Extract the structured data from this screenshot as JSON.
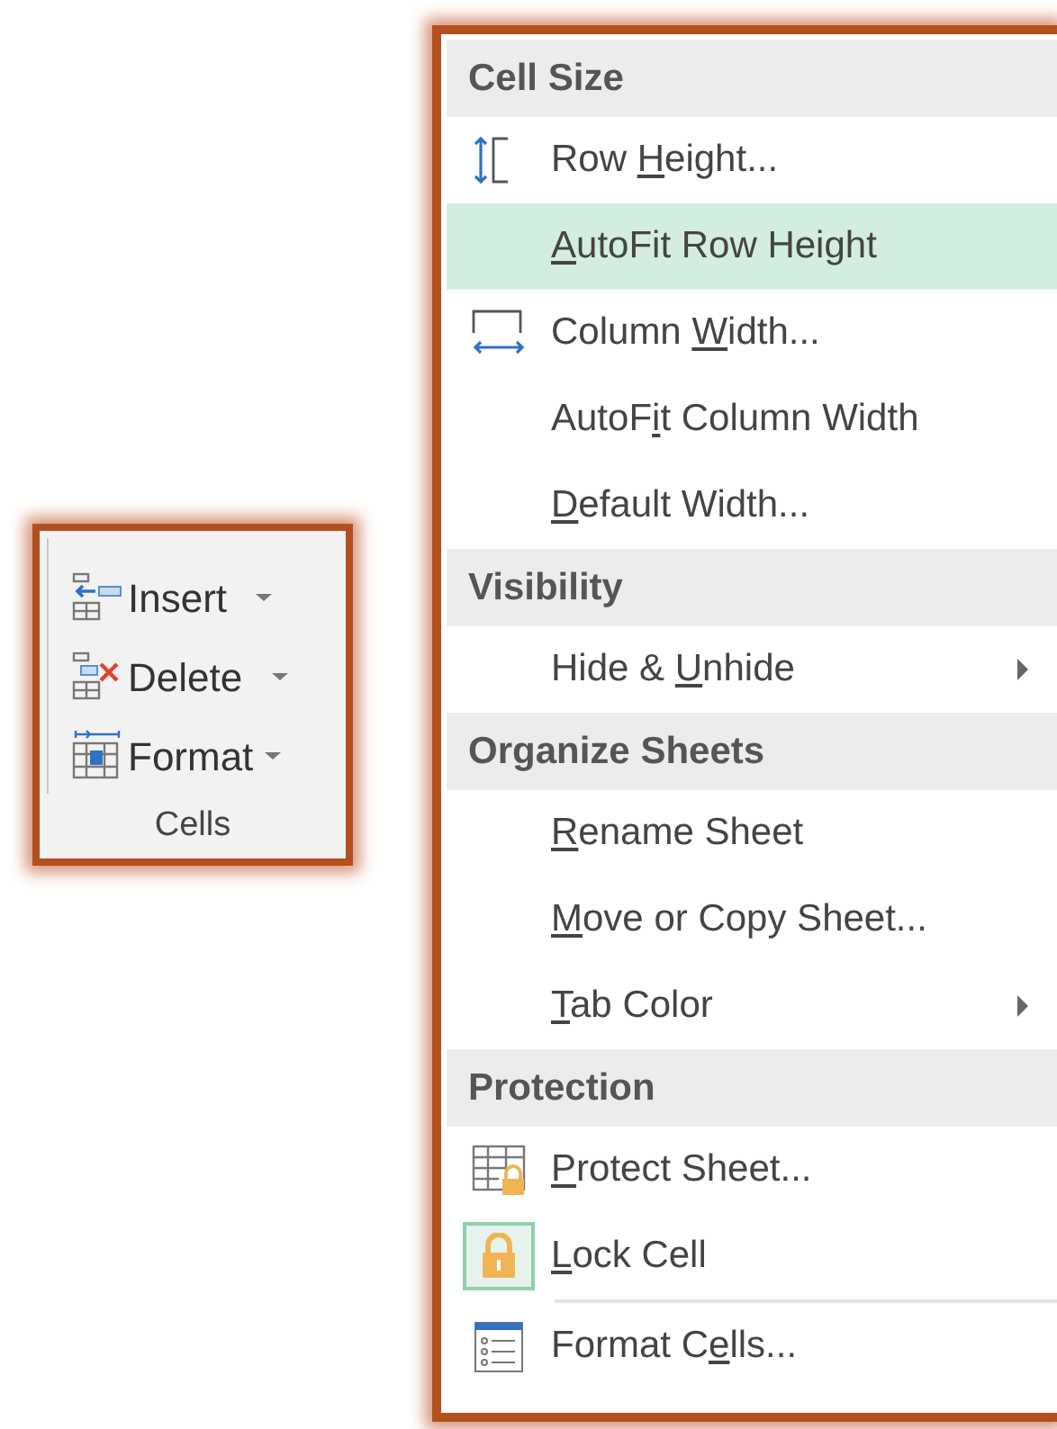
{
  "ribbon_group": {
    "label": "Cells",
    "buttons": [
      {
        "kind": "insert",
        "label": "Insert"
      },
      {
        "kind": "delete",
        "label": "Delete"
      },
      {
        "kind": "format",
        "label": "Format"
      }
    ]
  },
  "menu": {
    "sections": [
      {
        "heading": "Cell Size",
        "items": [
          {
            "kind": "height",
            "label": {
              "before": "Row ",
              "key": "H",
              "after": "eight..."
            },
            "highlighted": false,
            "submenu": false,
            "checked": false
          },
          {
            "kind": "plain",
            "label": {
              "key": "A",
              "after": "utoFit Row Height"
            },
            "highlighted": true,
            "submenu": false,
            "checked": false
          },
          {
            "kind": "width",
            "label": {
              "before": "Column ",
              "key": "W",
              "after": "idth..."
            },
            "highlighted": false,
            "submenu": false,
            "checked": false
          },
          {
            "kind": "plain",
            "label": {
              "before": "AutoF",
              "key": "i",
              "after": "t Column Width"
            },
            "highlighted": false,
            "submenu": false,
            "checked": false
          },
          {
            "kind": "plain",
            "label": {
              "key": "D",
              "after": "efault Width..."
            },
            "highlighted": false,
            "submenu": false,
            "checked": false
          }
        ]
      },
      {
        "heading": "Visibility",
        "items": [
          {
            "kind": "plain",
            "label": {
              "before": "Hide & ",
              "key": "U",
              "after": "nhide"
            },
            "highlighted": false,
            "submenu": true,
            "checked": false
          }
        ]
      },
      {
        "heading": "Organize Sheets",
        "items": [
          {
            "kind": "plain",
            "label": {
              "key": "R",
              "after": "ename Sheet"
            },
            "highlighted": false,
            "submenu": false,
            "checked": false
          },
          {
            "kind": "plain",
            "label": {
              "key": "M",
              "after": "ove or Copy Sheet..."
            },
            "highlighted": false,
            "submenu": false,
            "checked": false
          },
          {
            "kind": "plain",
            "label": {
              "key": "T",
              "after": "ab Color"
            },
            "highlighted": false,
            "submenu": true,
            "checked": false
          }
        ]
      },
      {
        "heading": "Protection",
        "items": [
          {
            "kind": "protect",
            "label": {
              "key": "P",
              "after": "rotect Sheet..."
            },
            "highlighted": false,
            "submenu": false,
            "checked": false
          },
          {
            "kind": "lock",
            "label": {
              "key": "L",
              "after": "ock Cell"
            },
            "highlighted": false,
            "submenu": false,
            "checked": true
          },
          {
            "kind": "cells",
            "label": {
              "before": "Format C",
              "key": "e",
              "after": "lls..."
            },
            "highlighted": false,
            "submenu": false,
            "checked": false,
            "separator_before": true
          }
        ]
      }
    ]
  }
}
